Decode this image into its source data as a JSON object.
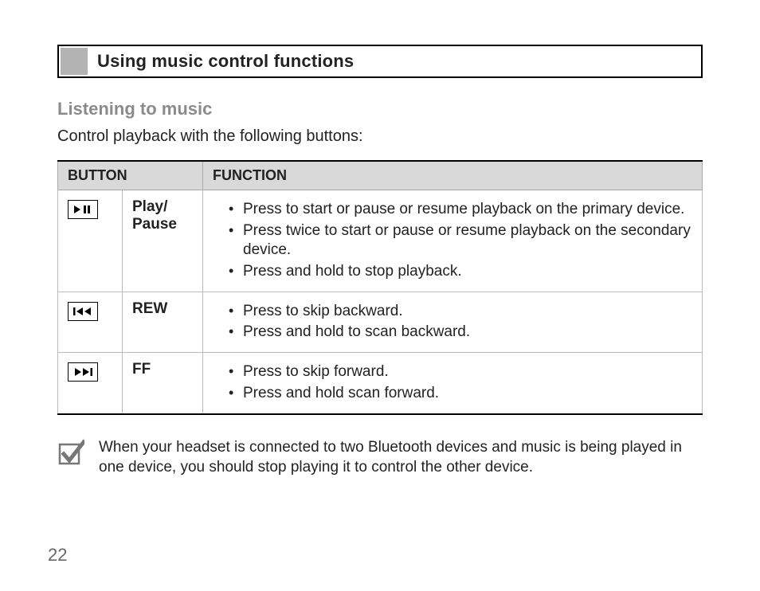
{
  "section_title": "Using music control functions",
  "subsection_title": "Listening to music",
  "lead_text": "Control playback with the following buttons:",
  "table": {
    "headers": {
      "button": "BUTTON",
      "function": "FUNCTION"
    },
    "rows": [
      {
        "icon": "play-pause",
        "label": "Play/\nPause",
        "items": [
          "Press to start or pause or resume playback on the primary device.",
          "Press twice to start or pause or resume playback on the secondary device.",
          "Press and hold to stop playback."
        ]
      },
      {
        "icon": "rew",
        "label": "REW",
        "items": [
          "Press to skip backward.",
          "Press and hold to scan backward."
        ]
      },
      {
        "icon": "ff",
        "label": "FF",
        "items": [
          "Press to skip forward.",
          "Press and hold scan forward."
        ]
      }
    ]
  },
  "note_text": "When your headset is connected to two Bluetooth devices and music is being played in one device, you should stop playing it to control the other device.",
  "page_number": "22"
}
